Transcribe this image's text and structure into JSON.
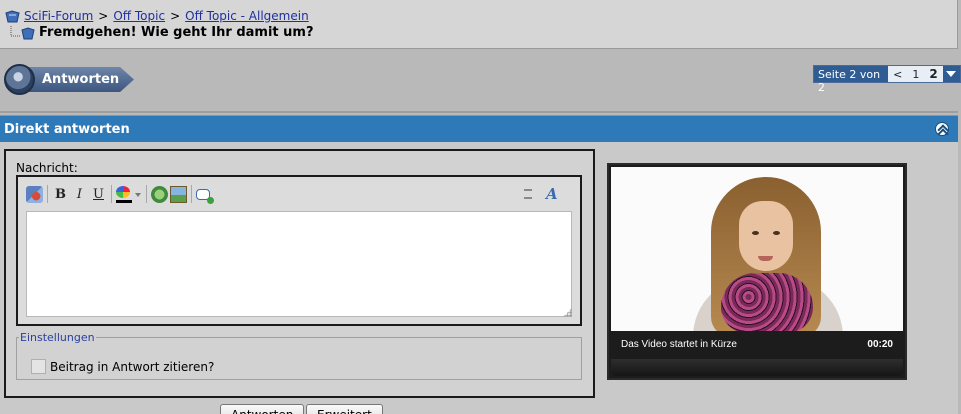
{
  "breadcrumb": {
    "items": [
      {
        "label": "SciFi-Forum"
      },
      {
        "label": "Off Topic"
      },
      {
        "label": "Off Topic - Allgemein"
      }
    ],
    "separator": ">",
    "thread_title": "Fremdgehen! Wie geht Ihr damit um?"
  },
  "reply_button": {
    "label": "Antworten"
  },
  "pagination": {
    "label": "Seite 2 von 2",
    "prev": "<",
    "pages": [
      "1",
      "2"
    ],
    "current": "2"
  },
  "quick_reply": {
    "title": "Direkt antworten",
    "message_label": "Nachricht:",
    "message_value": "",
    "toolbar": {
      "icons": [
        "remove-format-icon",
        "bold-icon",
        "italic-icon",
        "underline-icon",
        "text-color-icon",
        "insert-link-icon",
        "insert-image-icon",
        "wrap-quote-icon",
        "resize-editor-icon",
        "switch-mode-icon"
      ],
      "bold": "B",
      "italic": "I",
      "underline": "U",
      "mode": "A"
    },
    "settings": {
      "legend": "Einstellungen",
      "quote_checkbox_label": "Beitrag in Antwort zitieren?",
      "quote_checked": false
    },
    "buttons": {
      "submit": "Antworten",
      "advanced": "Erweitert"
    }
  },
  "video": {
    "status": "Das Video startet in Kürze",
    "time": "00:20"
  },
  "colors": {
    "header_blue": "#2e7ab8",
    "link": "#2030a0",
    "pager_blue": "#2f5d93"
  }
}
